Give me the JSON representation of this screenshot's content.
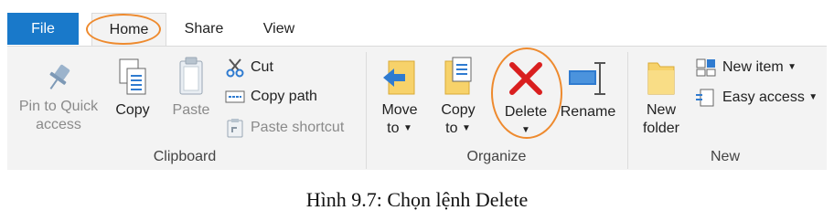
{
  "tabs": {
    "file": "File",
    "home": "Home",
    "share": "Share",
    "view": "View"
  },
  "clipboard": {
    "pin_line1": "Pin to Quick",
    "pin_line2": "access",
    "copy": "Copy",
    "paste": "Paste",
    "cut": "Cut",
    "copy_path": "Copy path",
    "paste_shortcut": "Paste shortcut",
    "label": "Clipboard"
  },
  "organize": {
    "move_line1": "Move",
    "move_line2": "to",
    "copy_line1": "Copy",
    "copy_line2": "to",
    "delete": "Delete",
    "rename": "Rename",
    "label": "Organize"
  },
  "new_group": {
    "new_folder_line1": "New",
    "new_folder_line2": "folder",
    "new_item": "New item",
    "easy_access": "Easy access",
    "label": "New"
  },
  "caption": "Hình 9.7: Chọn lệnh Delete",
  "colors": {
    "file_tab": "#1979ca",
    "annotation": "#ee8a2e",
    "delete_icon": "#d91f1f"
  }
}
